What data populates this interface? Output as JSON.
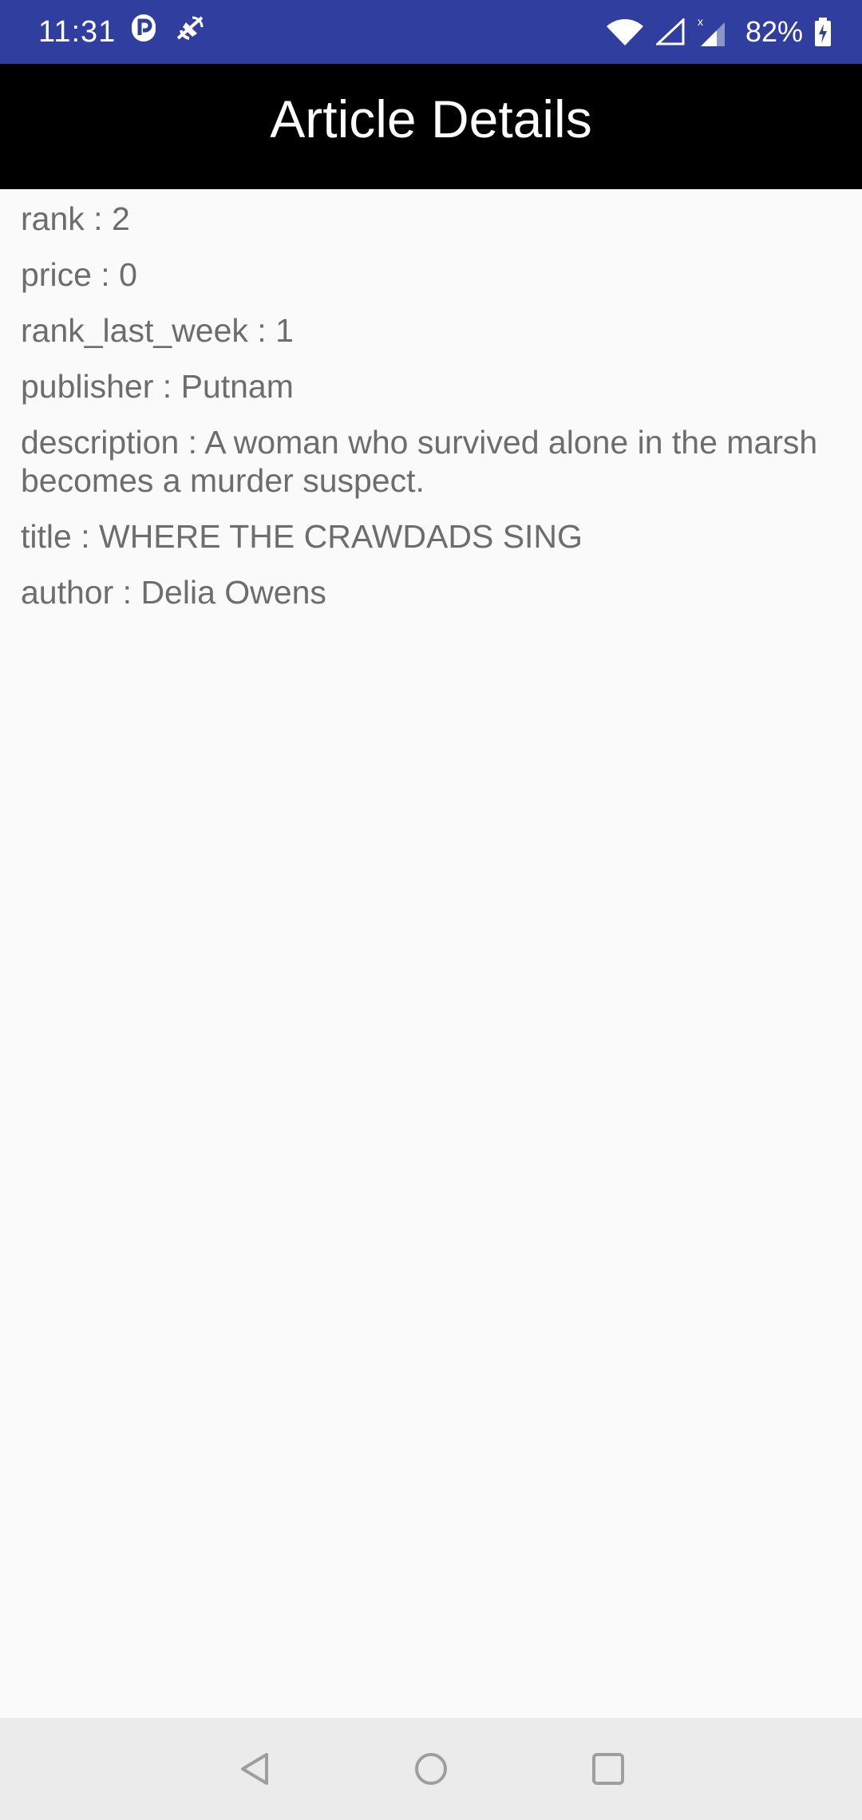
{
  "status_bar": {
    "time": "11:31",
    "battery": "82%",
    "icons": [
      "parking-icon",
      "no-signal-satellite-icon",
      "wifi-icon",
      "cell-signal-empty-icon",
      "cell-signal-x-icon",
      "battery-charging-icon"
    ],
    "background_color": "#303f9f"
  },
  "app_bar": {
    "title": "Article Details",
    "background_color": "#000000"
  },
  "details": [
    {
      "key": "rank",
      "sep": " : ",
      "value": "2"
    },
    {
      "key": "price",
      "sep": " : ",
      "value": "0"
    },
    {
      "key": "rank_last_week",
      "sep": " : ",
      "value": "1"
    },
    {
      "key": "publisher",
      "sep": " : ",
      "value": "Putnam"
    },
    {
      "key": "description",
      "sep": " : ",
      "value": "A woman who survived alone in the marsh becomes a murder suspect."
    },
    {
      "key": "title",
      "sep": " : ",
      "value": "WHERE THE CRAWDADS SING"
    },
    {
      "key": "author",
      "sep": " : ",
      "value": "Delia Owens"
    }
  ],
  "nav_bar": {
    "buttons": [
      "back-icon",
      "home-icon",
      "recents-icon"
    ]
  }
}
